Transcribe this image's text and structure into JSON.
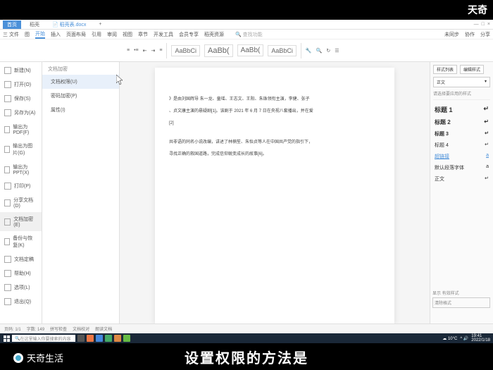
{
  "brand_corner": "天奇",
  "brand_logo": "天奇生活",
  "caption": "设置权限的方法是",
  "titlebar": {
    "home_tab": "首页",
    "app_tab": "稻壳",
    "doc_tab": "稻壳表.docx"
  },
  "ribbon_tabs": [
    "三 文件",
    "图",
    "开始",
    "插入",
    "页面布局",
    "引用",
    "审阅",
    "视图",
    "章节",
    "开发工具",
    "会员专享",
    "稻壳资源"
  ],
  "ribbon_search": "查找功能",
  "ribbon_right": [
    "未同步",
    "协作",
    "分享"
  ],
  "ribbon_styles": [
    "AaBbCi",
    "AaBb(",
    "AaBb(",
    "AaBbCi"
  ],
  "file_menu": {
    "title": "文件",
    "items": [
      "新建(N)",
      "打开(O)",
      "保存(S)",
      "另存为(A)",
      "输出为PDF(F)",
      "输出为图片(G)",
      "输出为PPT(X)",
      "打印(P)",
      "分享文档(D)",
      "文档加密(E)",
      "备份与恢复(K)",
      "文档定稿",
      "帮助(H)",
      "选项(L)",
      "退出(Q)"
    ]
  },
  "submenu": {
    "title": "文档加密",
    "items": [
      "文档权限(U)",
      "密码加密(P)",
      "属性(I)"
    ]
  },
  "document": {
    "para1": "》是由刘国辉导 朱一龙、童瑶、王志文、王阳、朱珠领衔主演，李健、张子",
    "para2": "、贞文康主演的悬疑剧[1]。该剧于 2021 年 6 月 7 日在央视八套播出，并在爱",
    "para3": "[2]",
    "para4": "共非语的同名小说改编，讲述了林楠笙、朱怡贞等人在中国共产党的指引下，",
    "para5": "寻找正确的救国道路，完成信仰蜕变成长的故事[6]。"
  },
  "side_panel": {
    "tabs": [
      "样式列表",
      "编辑样式"
    ],
    "current": "正文",
    "hint": "请选择要应用的样式",
    "styles": [
      "标题 1",
      "标题 2",
      "标题 3",
      "标题 4",
      "超链接",
      "默认段落字体",
      "正文"
    ],
    "bottom_label": "显示 有效样式",
    "clear": "清除格式"
  },
  "statusbar": {
    "page": "页码: 1/1",
    "words": "字数: 149",
    "spell": "拼写检查",
    "dup": "文档校对",
    "read": "朗读文档"
  },
  "taskbar": {
    "search": "在这里输入你要搜索的内容",
    "weather": "10°C",
    "time": "19:41",
    "date": "2022/1/18"
  }
}
